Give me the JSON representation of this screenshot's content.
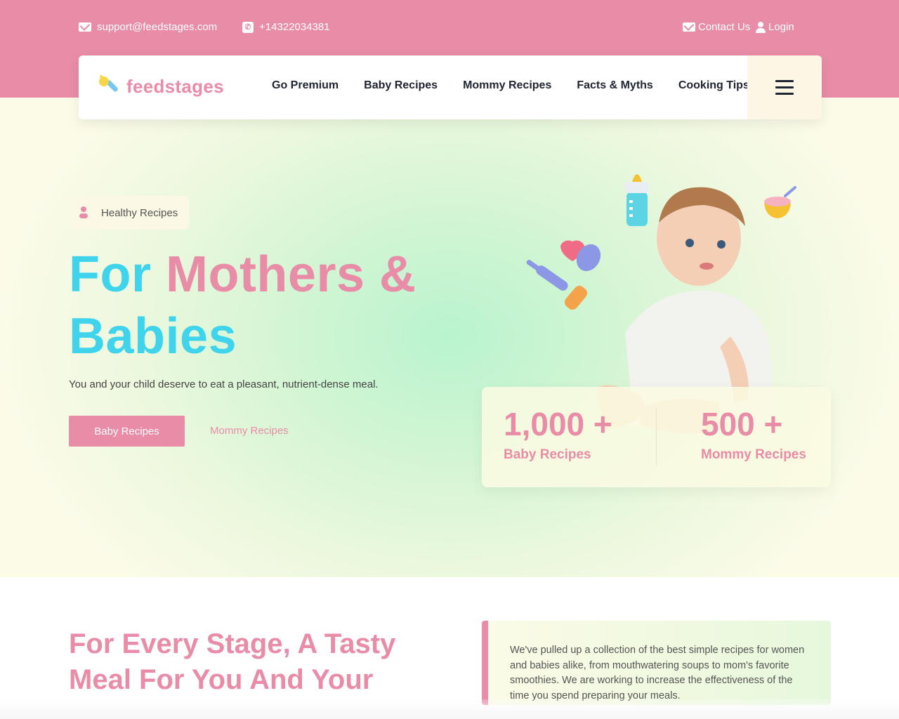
{
  "topbar": {
    "email": "support@feedstages.com",
    "phone": "+14322034381",
    "contact_label": "Contact Us",
    "login_label": "Login"
  },
  "nav": {
    "logo_text": "feedstages",
    "links": [
      "Go Premium",
      "Baby Recipes",
      "Mommy Recipes",
      "Facts & Myths",
      "Cooking Tips"
    ]
  },
  "hero": {
    "tag": "Healthy Recipes",
    "title_part1": "For",
    "title_part2": "Mothers &",
    "title_part3": "Babies",
    "description": "You and your child deserve to eat a pleasant, nutrient-dense meal.",
    "primary_button": "Baby Recipes",
    "secondary_link": "Mommy Recipes"
  },
  "stats": [
    {
      "value": "1,000 +",
      "label": "Baby Recipes"
    },
    {
      "value": "500 +",
      "label": "Mommy Recipes"
    }
  ],
  "about": {
    "title": "For Every Stage, A Tasty Meal For You And Your",
    "text": "We've pulled up a collection of the best simple recipes for women and babies alike, from mouthwatering soups to mom's favorite smoothies. We are working to increase the effectiveness of the time you spend preparing your meals."
  },
  "colors": {
    "brand_pink": "#e88ca7",
    "accent_cyan": "#3fd4ec",
    "cream": "#fcf6e4"
  }
}
